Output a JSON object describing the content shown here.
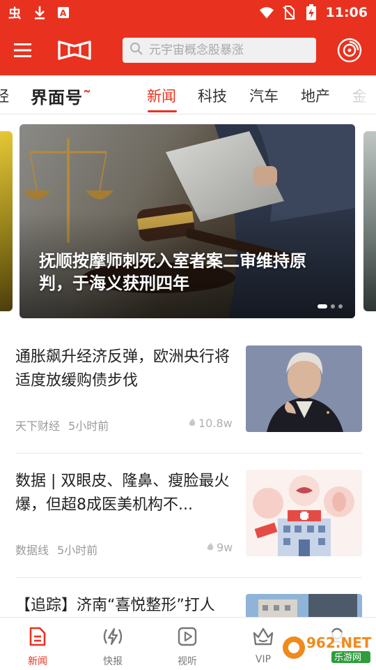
{
  "status_bar": {
    "time": "11:06",
    "icons": [
      "bug-icon",
      "download-icon",
      "a-box-icon",
      "wifi-icon",
      "no-sim-icon",
      "battery-charging-icon"
    ]
  },
  "app_bar": {
    "menu_icon": "hamburger-menu-icon",
    "logo_icon": "jiemian-logo-icon",
    "search_placeholder": "元宇宙概念股暴涨",
    "audio_icon": "audio-disc-icon"
  },
  "tabs": {
    "items": [
      "经",
      "界面号",
      "新闻",
      "科技",
      "汽车",
      "地产",
      "金"
    ],
    "active": "新闻"
  },
  "banner": {
    "title": "抚顺按摩师刺死入室者案二审维持原判，于海义获刑四年",
    "dots_total": 3,
    "dot_active": 1
  },
  "news": [
    {
      "title": "通胀飙升经济反弹，欧洲央行将适度放缓购债步伐",
      "source": "天下财经",
      "time": "5小时前",
      "views": "10.8w",
      "thumb": "woman-speaker-photo"
    },
    {
      "title": "数据 | 双眼皮、隆鼻、瘦脸最火爆，但超8成医美机构不...",
      "source": "数据线",
      "time": "5小时前",
      "views": "9w",
      "thumb": "cosmetic-hospital-illustration"
    },
    {
      "title": "【追踪】济南“喜悦整形”打人",
      "thumb": "building-photo"
    }
  ],
  "bottom_nav": {
    "items": [
      {
        "label": "新闻",
        "icon": "news-doc-icon"
      },
      {
        "label": "快报",
        "icon": "flash-broadcast-icon"
      },
      {
        "label": "视听",
        "icon": "play-video-icon"
      },
      {
        "label": "VIP",
        "icon": "vip-crown-icon"
      },
      {
        "label": "",
        "icon": "profile-icon"
      }
    ],
    "active": "新闻"
  },
  "watermark": {
    "text_main": "962.NET",
    "text_sub": "乐游网"
  },
  "colors": {
    "brand_red": "#e8321f",
    "text_primary": "#222222",
    "text_meta": "#9a9a9a"
  }
}
